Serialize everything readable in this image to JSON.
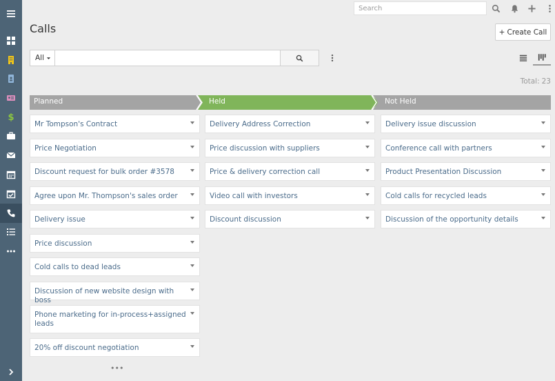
{
  "app": {
    "page_title": "Calls",
    "create_button": "Create Call",
    "create_icon": "+"
  },
  "topbar": {
    "search_placeholder": "Search",
    "icons": [
      "search-icon",
      "bell-icon",
      "plus-icon",
      "kebab-icon"
    ]
  },
  "sidebar": {
    "items": [
      {
        "icon": "menu-icon"
      },
      {
        "icon": "dashboard-icon"
      },
      {
        "icon": "building-icon",
        "color": "#f0c419"
      },
      {
        "icon": "contact-book-icon",
        "color": "#8fb4d8"
      },
      {
        "icon": "id-card-icon",
        "color": "#d98dbb"
      },
      {
        "icon": "dollar-icon",
        "color": "#8cc63f"
      },
      {
        "icon": "briefcase-icon"
      },
      {
        "icon": "envelope-icon"
      },
      {
        "icon": "calendar-icon"
      },
      {
        "icon": "calendar-check-icon"
      },
      {
        "icon": "phone-icon",
        "active": true
      },
      {
        "icon": "task-list-icon"
      },
      {
        "icon": "more-icon"
      }
    ],
    "bottom_icon": "chevron-right-icon"
  },
  "filter": {
    "scope_label": "All",
    "search_value": ""
  },
  "total": {
    "label": "Total:",
    "count": "23"
  },
  "colors": {
    "planned": "#a4a4a4",
    "held": "#80b55a",
    "not_held": "#a4a4a4",
    "link": "#4a6b8a",
    "sidebar": "#4d6476"
  },
  "columns": [
    {
      "title": "Planned",
      "cards": [
        "Mr Tompson's Contract",
        "Price Negotiation",
        "Discount request for bulk order #3578",
        "Agree upon Mr. Thompson's sales order",
        "Delivery issue",
        "Price discussion",
        "Cold calls to dead leads",
        "Discussion of new website design with boss",
        "Phone marketing for in-process+assigned leads",
        "20% off discount negotiation"
      ],
      "more": "•••"
    },
    {
      "title": "Held",
      "cards": [
        "Delivery Address Correction",
        "Price discussion with suppliers",
        "Price & delivery correction call",
        "Video call with investors",
        "Discount discussion"
      ]
    },
    {
      "title": "Not Held",
      "cards": [
        "Delivery issue discussion",
        "Conference call with partners",
        "Product Presentation Discussion",
        "Cold calls for recycled leads",
        "Discussion of the opportunity details"
      ]
    }
  ]
}
